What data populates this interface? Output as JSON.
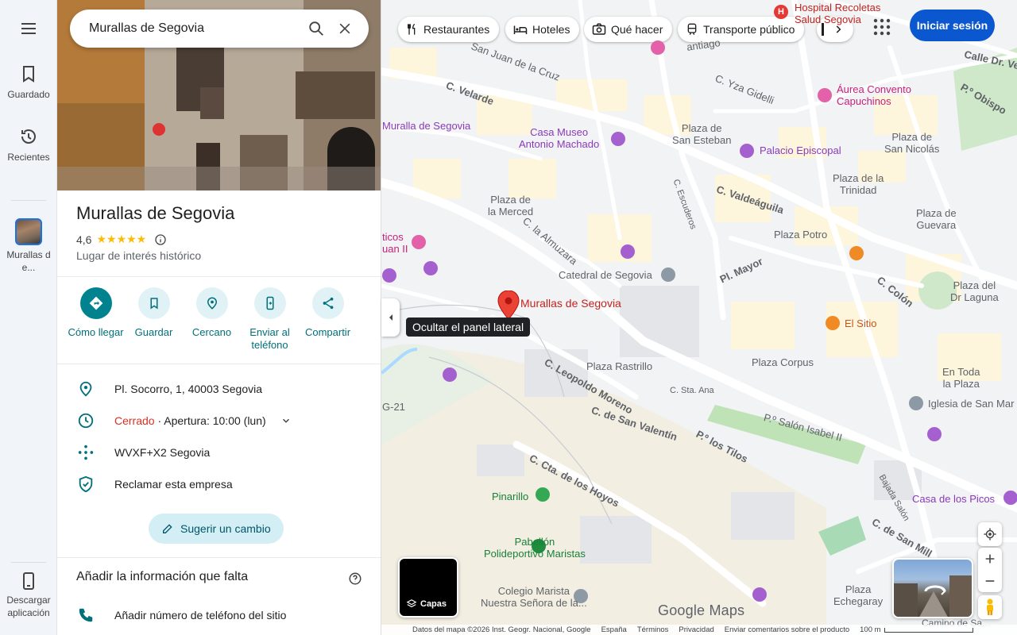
{
  "rail": {
    "saved_label": "Guardado",
    "recent_label": "Recientes",
    "place_label": "Murallas de...",
    "download_label": "Descargar aplicación"
  },
  "search": {
    "value": "Murallas de Segovia"
  },
  "place": {
    "title": "Murallas de Segovia",
    "rating": "4,6",
    "stars": "★★★★★",
    "category": "Lugar de interés histórico"
  },
  "actions": [
    {
      "label": "Cómo llegar",
      "icon": "directions-icon"
    },
    {
      "label": "Guardar",
      "icon": "bookmark-icon"
    },
    {
      "label": "Cercano",
      "icon": "nearby-icon"
    },
    {
      "label": "Enviar al teléfono",
      "icon": "send-to-phone-icon"
    },
    {
      "label": "Compartir",
      "icon": "share-icon"
    }
  ],
  "info": {
    "address": "Pl. Socorro, 1, 40003 Segovia",
    "hours_status": "Cerrado",
    "hours_detail": " · Apertura: 10:00 (lun)",
    "plus_code": "WVXF+X2 Segovia",
    "claim": "Reclamar esta empresa"
  },
  "suggest_label": "Sugerir un cambio",
  "missing": {
    "heading": "Añadir la información que falta",
    "phone": "Añadir número de teléfono del sitio"
  },
  "chips": [
    "Restaurantes",
    "Hoteles",
    "Qué hacer",
    "Transporte público"
  ],
  "signin_label": "Iniciar sesión",
  "tooltip": "Ocultar el panel lateral",
  "layers_label": "Capas",
  "map_labels": {
    "hospital": "Hospital Recoletas\nSalud Segovia",
    "aurea": "Áurea Convento\nCapuchinos",
    "muralla": "Muralla de Segovia",
    "casa_museo": "Casa Museo\nAntonio Machado",
    "plaza_esteban": "Plaza de\nSan Esteban",
    "palacio": "Palacio Episcopal",
    "plaza_nicolas": "Plaza de\nSan Nicolás",
    "plaza_trinidad": "Plaza de la\nTrinidad",
    "plaza_merced": "Plaza de\nla Merced",
    "plaza_potro": "Plaza Potro",
    "plaza_guevara": "Plaza de\nGuevara",
    "catedral": "Catedral de Segovia",
    "murallas_pin": "Murallas de Segovia",
    "plaza_laguna": "Plaza del\nDr Laguna",
    "el_sitio": "El Sitio",
    "plaza_rastrillo": "Plaza Rastrillo",
    "plaza_corpus": "Plaza Corpus",
    "en_toda": "En Toda\nla Plaza",
    "iglesia": "Iglesia de San Mar",
    "c_sta_ana": "C. Sta. Ana",
    "pinarillo": "Pinarillo",
    "pabellon": "Pabellón\nPolideportivo Maristas",
    "colegio": "Colegio Marista\nNuestra Señora de la...",
    "plaza_echegaray": "Plaza\nEchegaray",
    "casa_picos": "Casa de los Picos",
    "camino": "Camino de Sa...",
    "ticos": "ticos\nuan II",
    "road_velarde": "C. Velarde",
    "road_yza": "C. Yza Gidelli",
    "road_valdeaguila": "C. Valdeáguila",
    "road_escuderos": "C. Escuderos",
    "road_almuzara": "C. la Almuzara",
    "road_mayor": "Pl. Mayor",
    "road_colon": "C. Colón",
    "road_leopoldo": "C. Leopoldo Moreno",
    "road_valentin": "C. de San Valentín",
    "road_tilos": "P.º los Tilos",
    "road_salon": "P.º Salón Isabel II",
    "road_hoyos": "C. Cta. de los Hoyos",
    "road_san_juan": "San Juan de la Cruz",
    "road_obispo": "P.º Obispo",
    "road_dr_vel": "Calle Dr. Ve",
    "road_santiago": "antiago",
    "road_millan": "C. de San Mill",
    "road_bajada": "Bajada Salón",
    "road_g21": "G-21"
  },
  "footer": {
    "data": "Datos del mapa ©2026 Inst. Geogr. Nacional, Google",
    "country": "España",
    "terms": "Términos",
    "privacy": "Privacidad",
    "feedback": "Enviar comentarios sobre el producto",
    "scale": "100 m"
  },
  "google_maps_logo": "Google Maps",
  "colors": {
    "teal": "#00838f",
    "signin": "#0b57d0",
    "closed": "#d93025",
    "pin": "#ea4335"
  }
}
